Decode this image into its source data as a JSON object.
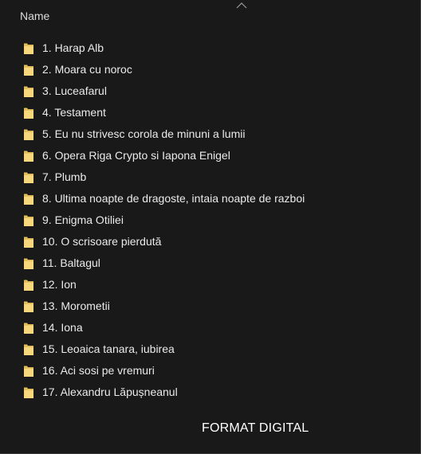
{
  "header": {
    "column_name": "Name",
    "sort_indicator": "chevron-up-icon"
  },
  "folders": [
    {
      "label": "1. Harap Alb"
    },
    {
      "label": "2. Moara cu noroc"
    },
    {
      "label": "3. Luceafarul"
    },
    {
      "label": "4. Testament"
    },
    {
      "label": "5. Eu nu strivesc corola de minuni a lumii"
    },
    {
      "label": "6. Opera Riga Crypto si Iapona Enigel"
    },
    {
      "label": "7. Plumb"
    },
    {
      "label": "8. Ultima noapte de dragoste, intaia noapte de razboi"
    },
    {
      "label": "9. Enigma Otiliei"
    },
    {
      "label": "10. O scrisoare pierdută"
    },
    {
      "label": "11. Baltagul"
    },
    {
      "label": "12. Ion"
    },
    {
      "label": "13. Morometii"
    },
    {
      "label": "14. Iona"
    },
    {
      "label": "15. Leoaica tanara, iubirea"
    },
    {
      "label": "16. Aci sosi pe vremuri"
    },
    {
      "label": "17. Alexandru Lăpușneanul"
    }
  ],
  "caption": "FORMAT DIGITAL",
  "colors": {
    "background": "#191919",
    "folder_body": "#E8C25A",
    "folder_front": "#F6D77B",
    "text": "#EAEAEA"
  }
}
